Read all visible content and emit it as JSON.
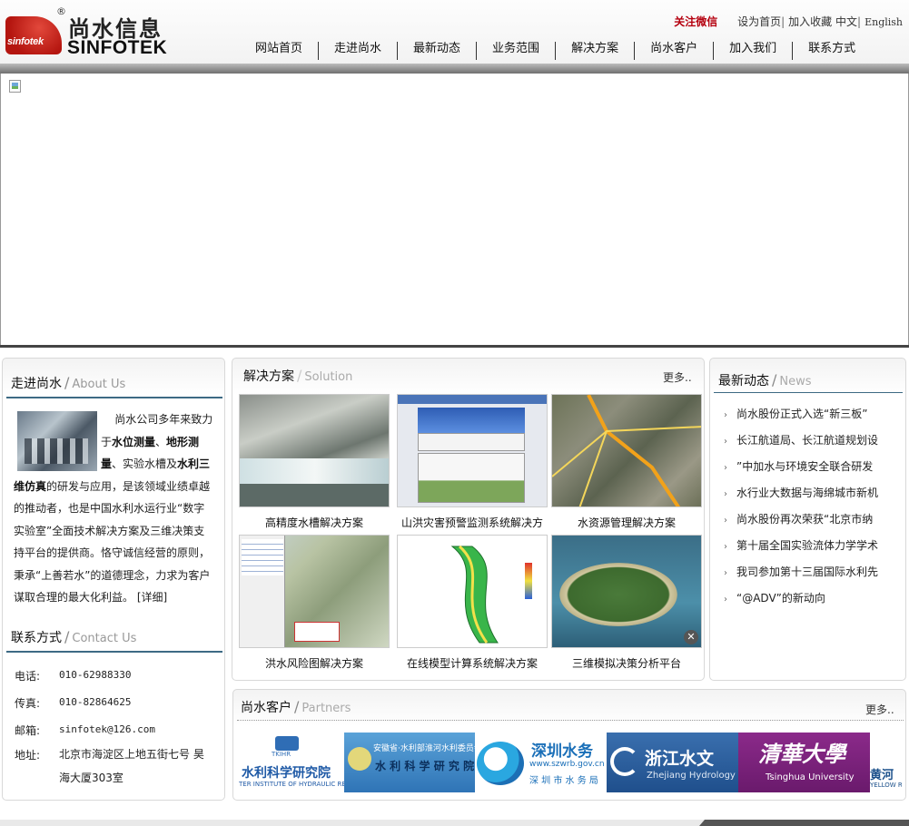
{
  "brand": {
    "logo_badge": "sinfotek",
    "reg_mark": "®",
    "name_cn": "尚水信息",
    "name_en": "SINFOTEK"
  },
  "toplinks": {
    "wechat": "关注微信",
    "set_homepage": "设为首页",
    "add_favorite": "加入收藏",
    "lang_cn": "中文",
    "lang_en": "English",
    "sep": "|"
  },
  "nav": [
    "网站首页",
    "走进尚水",
    "最新动态",
    "业务范围",
    "解决方案",
    "尚水客户",
    "加入我们",
    "联系方式"
  ],
  "about": {
    "title_cn": "走进尚水",
    "title_en": "About Us",
    "p1": "尚水公司多年来致力于",
    "b1": "水位测量",
    "t2": "、",
    "b2": "地形测量",
    "t3": "、实验水槽及",
    "b3": "水利三维仿真",
    "t4": "的研发与应用，是该领域业绩卓越的推动者，也是中国水利水运行业“数字实验室”全面技术解决方案及三维决策支持平台的提供商。恪守诚信经营的原则，秉承“上善若水”的道德理念，力求为客户谋取合理的最大化利益。",
    "detail": "[详细]"
  },
  "contact": {
    "title_cn": "联系方式",
    "title_en": "Contact Us",
    "phone_label": "电话:",
    "phone": "010-62988330",
    "fax_label": "传真:",
    "fax": "010-82864625",
    "email_label": "邮箱:",
    "email": "sinfotek@126.com",
    "address_label": "地址:",
    "address": "北京市海淀区上地五街七号 昊海大厦303室"
  },
  "solutions": {
    "title_cn": "解决方案",
    "title_en": "Solution",
    "more": "更多..",
    "items": [
      "高精度水槽解决方案",
      "山洪灾害预警监测系统解决方",
      "水资源管理解决方案",
      "洪水风险图解决方案",
      "在线模型计算系统解决方案",
      "三维模拟决策分析平台"
    ]
  },
  "news": {
    "title_cn": "最新动态",
    "title_en": "News",
    "arrow": "›",
    "items": [
      "尚水股份正式入选“新三板”",
      "长江航道局、长江航道规划设",
      "”中加水与环境安全联合研发",
      "水行业大数据与海绵城市新机",
      "尚水股份再次荣获“北京市纳",
      "第十届全国实验流体力学学术",
      "我司参加第十三届国际水利先",
      "“@ADV”的新动向"
    ]
  },
  "partners": {
    "title_cn": "尚水客户",
    "title_en": "Partners",
    "more": "更多..",
    "logos": [
      {
        "cn": "水利科学研究院",
        "sub": "TKIHR",
        "en": "TER INSTITUTE OF HYDRAULIC RESEARCH"
      },
      {
        "cn": "水 利 科 学 研 究 院",
        "sub": "安徽省·水利部淮河水利委员会"
      },
      {
        "cn": "深圳水务",
        "sub": "www.szwrb.gov.cn",
        "en": "深 圳 市 水 务 局"
      },
      {
        "cn": "浙江水文",
        "en": "Zhejiang Hydrology"
      },
      {
        "cn": "清華大學",
        "en": "Tsinghua University"
      },
      {
        "cn": "黄河",
        "en": "YELLOW RI"
      }
    ]
  },
  "colors": {
    "accent_red": "#b5000f",
    "section_rule": "#3d6a84"
  }
}
